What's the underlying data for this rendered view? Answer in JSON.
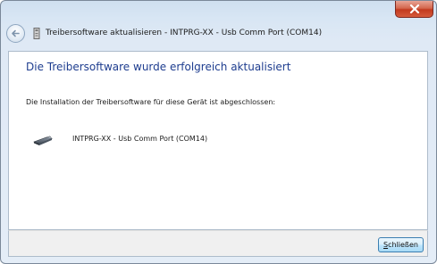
{
  "window": {
    "title": "Treibersoftware aktualisieren - INTPRG-XX - Usb Comm Port (COM14)"
  },
  "titlebar": {
    "close_icon": "close-x-icon",
    "back_icon": "back-arrow-icon",
    "title_icon": "device-manager-icon"
  },
  "main": {
    "heading": "Die Treibersoftware wurde erfolgreich aktualisiert",
    "message": "Die Installation der Treibersoftware für diese Gerät ist abgeschlossen:",
    "device": {
      "icon": "usb-device-icon",
      "name": "INTPRG-XX - Usb Comm Port (COM14)"
    }
  },
  "footer": {
    "close_button": {
      "mnemonic": "S",
      "rest": "chließen"
    }
  },
  "colors": {
    "heading": "#1e3d8f",
    "close_red": "#c2391f",
    "frame": "#d8e6f4"
  }
}
